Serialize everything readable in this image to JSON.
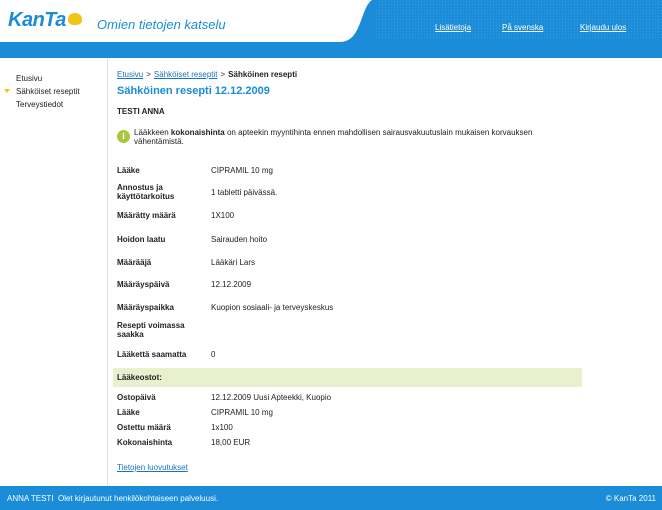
{
  "header": {
    "logo": "KanTa",
    "title": "Omien tietojen katselu",
    "links": [
      "Lisätietoja",
      "På svenska",
      "Kirjaudu ulos"
    ]
  },
  "nav": {
    "items": [
      "Etusivu",
      "Sähköiset reseptit",
      "Terveystiedot"
    ]
  },
  "breadcrumb": {
    "items": [
      "Etusivu",
      "Sähköiset reseptit"
    ],
    "separator": ">",
    "current": "Sähköinen resepti"
  },
  "page": {
    "title": "Sähköinen resepti 12.12.2009",
    "patient": "TESTI ANNA",
    "info_icon": "i",
    "info_pre": "Lääkkeen ",
    "info_bold": "kokonaishinta",
    "info_post": " on apteekin myyntihinta ennen mahdollisen sairausvakuutuslain mukaisen korvauksen vähentämistä."
  },
  "prescription": [
    {
      "label": "Lääke",
      "value": "CIPRAMIL 10 mg"
    },
    {
      "label": "Annostus ja käyttötarkoitus",
      "value": "1 tabletti päivässä."
    },
    {
      "label": "Määrätty määrä",
      "value": "1X100"
    },
    {
      "label": "Hoidon laatu",
      "value": "Sairauden hoito"
    },
    {
      "label": "Määrääjä",
      "value": "Lääkäri Lars"
    },
    {
      "label": "Määräyspäivä",
      "value": "12.12.2009"
    },
    {
      "label": "Määräyspaikka",
      "value": "Kuopion sosiaali- ja terveyskeskus"
    },
    {
      "label": "Resepti voimassa saakka",
      "value": ""
    },
    {
      "label": "Lääkettä saamatta",
      "value": "0"
    }
  ],
  "purchases": {
    "heading": "Lääkeostot:",
    "rows": [
      {
        "label": "Ostopäivä",
        "value": "12.12.2009 Uusi Apteekki, Kuopio"
      },
      {
        "label": "Lääke",
        "value": "CIPRAMIL 10 mg"
      },
      {
        "label": "Ostettu määrä",
        "value": "1x100"
      },
      {
        "label": "Kokonaishinta",
        "value": "18,00 EUR"
      }
    ]
  },
  "footer_link": "Tietojen luovutukset",
  "bottom": {
    "user": "ANNA TESTI",
    "status": "Olet kirjautunut henkilökohtaiseen palveluusi.",
    "copyright": "© KanTa 2011"
  },
  "colors": {
    "brand_blue": "#1a8cd8",
    "info_green": "#a8c83c",
    "purchase_bar": "#e9f0cd"
  }
}
